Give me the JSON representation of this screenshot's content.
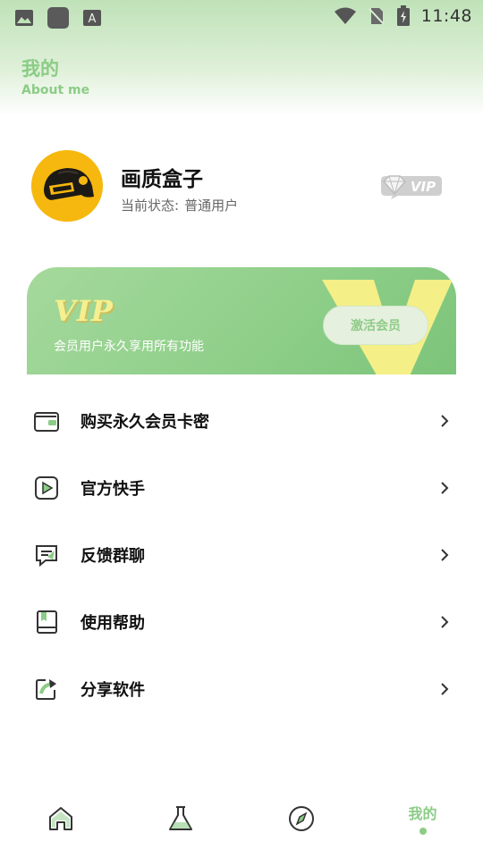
{
  "status_bar": {
    "time": "11:48",
    "left_icons": [
      "image-icon",
      "app-icon",
      "font-icon"
    ],
    "right_icons": [
      "wifi-icon",
      "no-sim-icon",
      "battery-charging-icon"
    ]
  },
  "header": {
    "title": "我的",
    "subtitle": "About me"
  },
  "profile": {
    "name": "画质盒子",
    "status_label": "当前状态:",
    "status_value": "普通用户",
    "badge": "VIP"
  },
  "vip_card": {
    "title": "VIP",
    "description": "会员用户永久享用所有功能",
    "button_label": "激活会员",
    "watermark_letter": "V"
  },
  "menu": {
    "items": [
      {
        "label": "购买永久会员卡密",
        "icon": "wallet-icon"
      },
      {
        "label": "官方快手",
        "icon": "video-play-icon"
      },
      {
        "label": "反馈群聊",
        "icon": "chat-icon"
      },
      {
        "label": "使用帮助",
        "icon": "book-icon"
      },
      {
        "label": "分享软件",
        "icon": "share-icon"
      }
    ]
  },
  "bottom_nav": {
    "items": [
      {
        "icon": "home-icon"
      },
      {
        "icon": "flask-icon"
      },
      {
        "icon": "compass-icon"
      },
      {
        "label": "我的",
        "active": true
      }
    ]
  },
  "colors": {
    "accent": "#8bcc86",
    "vip_gold": "#f6ef8f",
    "avatar_bg": "#f6b80f"
  }
}
